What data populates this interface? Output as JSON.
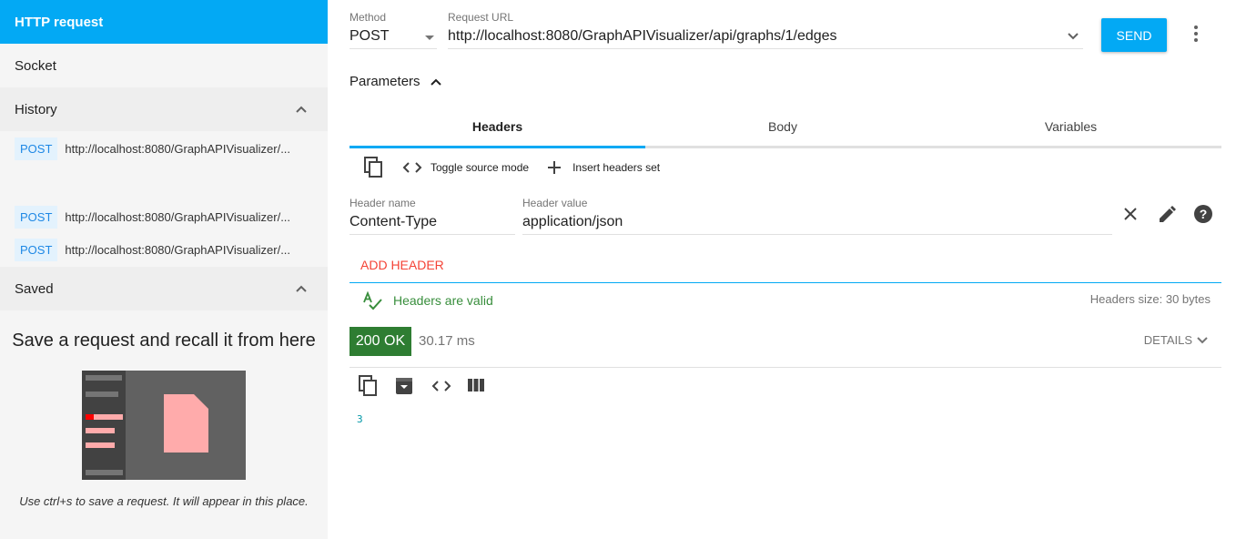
{
  "sidebar": {
    "http_request": "HTTP request",
    "socket": "Socket",
    "history": "History",
    "history_items": [
      {
        "method": "POST",
        "url": "http://localhost:8080/GraphAPIVisualizer/..."
      },
      {
        "method": "POST",
        "url": "http://localhost:8080/GraphAPIVisualizer/..."
      },
      {
        "method": "POST",
        "url": "http://localhost:8080/GraphAPIVisualizer/..."
      }
    ],
    "saved": "Saved",
    "empty_title": "Save a request and recall it from here",
    "empty_help": "Use ctrl+s to save a request. It will appear in this place."
  },
  "request": {
    "method_label": "Method",
    "method": "POST",
    "url_label": "Request URL",
    "url": "http://localhost:8080/GraphAPIVisualizer/api/graphs/1/edges",
    "send": "SEND"
  },
  "params": {
    "label": "Parameters",
    "tabs": [
      "Headers",
      "Body",
      "Variables"
    ],
    "toolbar": {
      "toggle": "Toggle source mode",
      "insert": "Insert headers set"
    },
    "header": {
      "name_label": "Header name",
      "name": "Content-Type",
      "value_label": "Header value",
      "value": "application/json"
    },
    "add_header": "ADD HEADER",
    "valid": "Headers are valid",
    "size": "Headers size: 30 bytes"
  },
  "response": {
    "status": "200 OK",
    "time": "30.17 ms",
    "details": "DETAILS",
    "body": "3"
  },
  "colors": {
    "accent": "#03a9f4",
    "success": "#2e7d32",
    "error": "#f44336"
  }
}
